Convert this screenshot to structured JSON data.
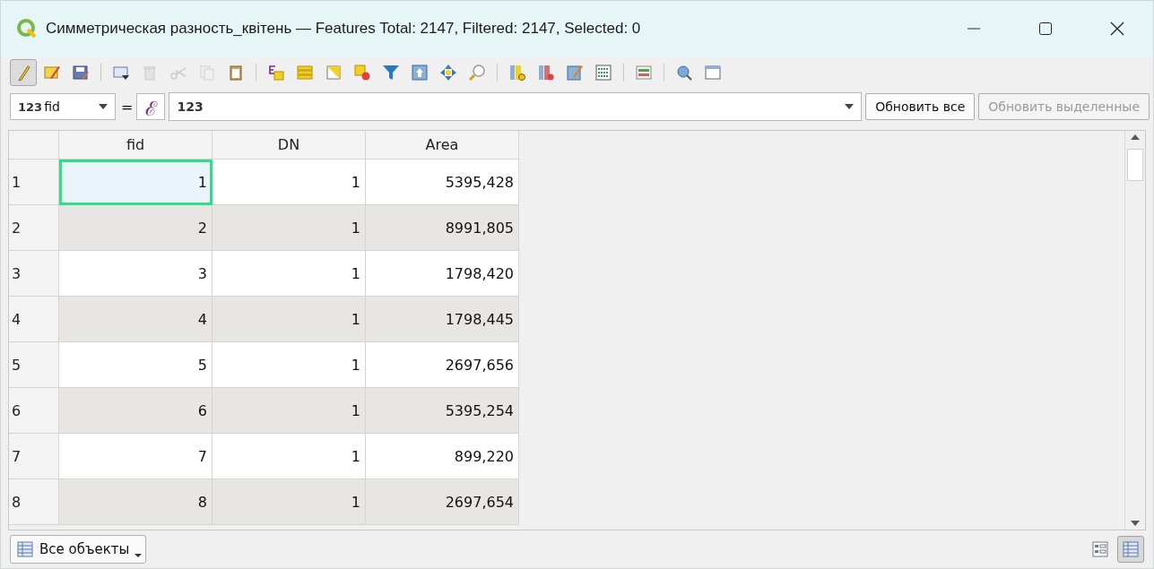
{
  "window": {
    "title": "Симметрическая разность_квітень — Features Total: 2147, Filtered: 2147, Selected: 0"
  },
  "toolbar": [
    [
      {
        "kind": "pencil",
        "active": true,
        "disabled": false
      },
      {
        "kind": "multi-edit",
        "active": false,
        "disabled": false
      },
      {
        "kind": "save",
        "active": false,
        "disabled": false
      }
    ],
    [
      {
        "kind": "add-row",
        "active": false,
        "disabled": false
      },
      {
        "kind": "trash",
        "active": false,
        "disabled": true
      },
      {
        "kind": "scissors",
        "active": false,
        "disabled": true
      },
      {
        "kind": "copy",
        "active": false,
        "disabled": true
      },
      {
        "kind": "clipboard",
        "active": false,
        "disabled": false
      }
    ],
    [
      {
        "kind": "expression",
        "active": false,
        "disabled": false
      },
      {
        "kind": "stack",
        "active": false,
        "disabled": false
      },
      {
        "kind": "invert",
        "active": false,
        "disabled": false
      },
      {
        "kind": "deselect",
        "active": false,
        "disabled": false
      },
      {
        "kind": "funnel",
        "active": false,
        "disabled": false
      },
      {
        "kind": "move-top",
        "active": false,
        "disabled": false
      },
      {
        "kind": "pan",
        "active": false,
        "disabled": false
      },
      {
        "kind": "magnifier",
        "active": false,
        "disabled": false
      }
    ],
    [
      {
        "kind": "add-column",
        "active": false,
        "disabled": false
      },
      {
        "kind": "remove-column",
        "active": false,
        "disabled": false
      },
      {
        "kind": "calculator",
        "active": false,
        "disabled": false
      },
      {
        "kind": "abacus",
        "active": false,
        "disabled": false
      }
    ],
    [
      {
        "kind": "form",
        "active": false,
        "disabled": false
      }
    ],
    [
      {
        "kind": "zoom-cursor",
        "active": false,
        "disabled": false
      },
      {
        "kind": "window",
        "active": false,
        "disabled": false
      }
    ]
  ],
  "filter_bar": {
    "field_type": "123",
    "field": "fid",
    "operator": "=",
    "expression_symbol": "ℰ",
    "value": "123",
    "buttons": [
      {
        "label": "Обновить все",
        "disabled": false
      },
      {
        "label": "Обновить выделенные",
        "disabled": true
      }
    ]
  },
  "table": {
    "columns": [
      "fid",
      "DN",
      "Area"
    ],
    "rows": [
      {
        "header": "1",
        "cells": [
          {
            "text": "1",
            "current": true
          },
          {
            "text": "1",
            "current": false
          },
          {
            "text": "5395,428",
            "current": false
          }
        ]
      },
      {
        "header": "2",
        "cells": [
          {
            "text": "2",
            "current": false
          },
          {
            "text": "1",
            "current": false
          },
          {
            "text": "8991,805",
            "current": false
          }
        ]
      },
      {
        "header": "3",
        "cells": [
          {
            "text": "3",
            "current": false
          },
          {
            "text": "1",
            "current": false
          },
          {
            "text": "1798,420",
            "current": false
          }
        ]
      },
      {
        "header": "4",
        "cells": [
          {
            "text": "4",
            "current": false
          },
          {
            "text": "1",
            "current": false
          },
          {
            "text": "1798,445",
            "current": false
          }
        ]
      },
      {
        "header": "5",
        "cells": [
          {
            "text": "5",
            "current": false
          },
          {
            "text": "1",
            "current": false
          },
          {
            "text": "2697,656",
            "current": false
          }
        ]
      },
      {
        "header": "6",
        "cells": [
          {
            "text": "6",
            "current": false
          },
          {
            "text": "1",
            "current": false
          },
          {
            "text": "5395,254",
            "current": false
          }
        ]
      },
      {
        "header": "7",
        "cells": [
          {
            "text": "7",
            "current": false
          },
          {
            "text": "1",
            "current": false
          },
          {
            "text": "899,220",
            "current": false
          }
        ]
      },
      {
        "header": "8",
        "cells": [
          {
            "text": "8",
            "current": false
          },
          {
            "text": "1",
            "current": false
          },
          {
            "text": "2697,654",
            "current": false
          }
        ]
      }
    ]
  },
  "bottom_bar": {
    "filter_button": "Все объекты",
    "views": [
      {
        "kind": "form",
        "selected": false
      },
      {
        "kind": "table",
        "selected": true
      }
    ]
  }
}
